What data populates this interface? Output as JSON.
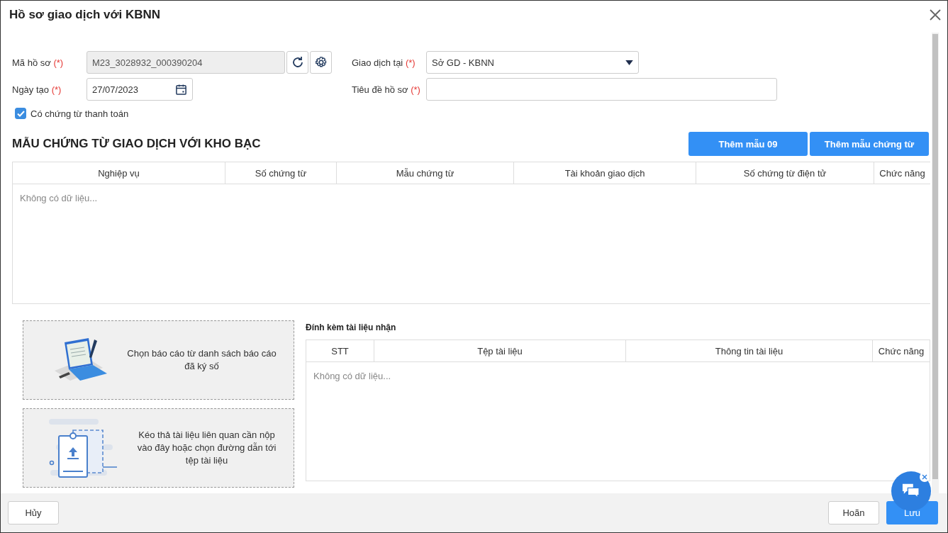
{
  "window": {
    "title": "Hồ sơ giao dịch với KBNN"
  },
  "form": {
    "fields": [
      {
        "kind": "readonly",
        "label": "Mã hồ sơ",
        "required_mark": "(*)",
        "value": "M23_3028932_000390204"
      },
      {
        "kind": "select",
        "label": "Giao dịch tại",
        "required_mark": "(*)",
        "value": "Sở GD - KBNN"
      },
      {
        "kind": "date",
        "label": "Ngày tạo",
        "required_mark": "(*)",
        "value": "27/07/2023"
      },
      {
        "kind": "text",
        "label": "Tiêu đề hồ sơ",
        "required_mark": "(*)"
      }
    ],
    "checkbox": {
      "label": "Có chứng từ thanh toán",
      "checked": true
    }
  },
  "section": {
    "title": "MẪU CHỨNG TỪ GIAO DỊCH VỚI KHO BẠC",
    "buttons": [
      "Thêm mẫu 09",
      "Thêm mẫu chứng từ"
    ]
  },
  "table": {
    "columns": [
      "Nghiệp vụ",
      "Số chứng từ",
      "Mẫu chứng từ",
      "Tài khoản giao dịch",
      "Số chứng từ điện tử",
      "Chức năng"
    ],
    "empty_text": "Không có dữ liệu..."
  },
  "drop_zones": [
    {
      "kind": "signed",
      "text": "Chọn báo cáo từ danh sách báo cáo đã ký số"
    },
    {
      "kind": "upload",
      "text": "Kéo thả tài liệu liên quan cần nộp vào đây hoặc chọn đường dẫn tới tệp tài liệu"
    }
  ],
  "attachments": {
    "title": "Đính kèm tài liệu nhận",
    "columns": [
      "STT",
      "Tệp tài liệu",
      "Thông tin tài liệu",
      "Chức năng"
    ],
    "empty_text": "Không có dữ liệu..."
  },
  "footer": {
    "cancel": "Hủy",
    "defer": "Hoãn",
    "save": "Lưu"
  }
}
